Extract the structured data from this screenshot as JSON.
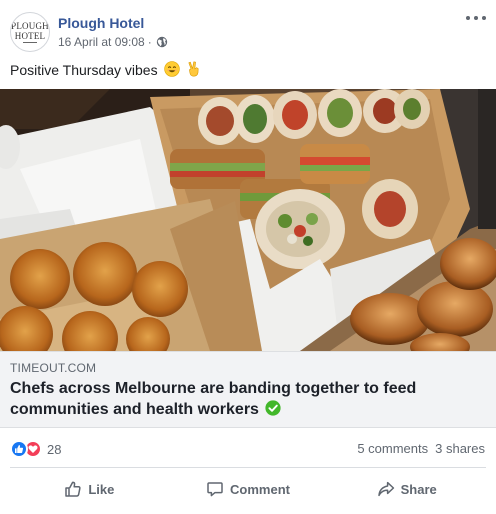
{
  "post": {
    "page_name": "Plough Hotel",
    "timestamp": "16 April at 09:08",
    "separator": "·",
    "privacy_icon": "globe-icon",
    "body_text": "Positive Thursday vibes",
    "emojis": [
      "smiling-face-icon",
      "victory-hand-icon"
    ],
    "avatar": {
      "line1": "PLOUGH",
      "line2": "HOTEL"
    }
  },
  "link": {
    "image_icon": "food-platter-image",
    "domain": "TIMEOUT.COM",
    "title": "Chefs across Melbourne are banding together to feed communities and health workers",
    "title_icon": "green-check-icon"
  },
  "engagement": {
    "reaction_count": "28",
    "comments": "5 comments",
    "shares": "3 shares"
  },
  "actions": {
    "like": "Like",
    "comment": "Comment",
    "share": "Share"
  },
  "colors": {
    "page_name": "#385898",
    "like_reaction": "#1877f2",
    "love_reaction": "#f33e58",
    "verified": "#42b72a"
  }
}
